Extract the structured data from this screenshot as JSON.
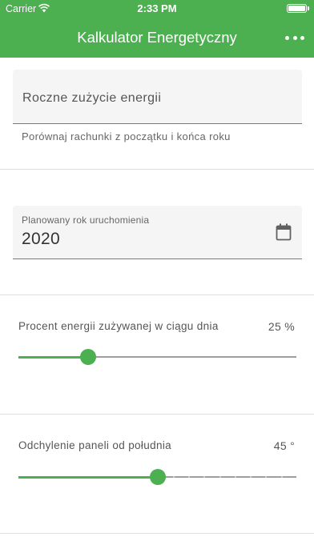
{
  "status_bar": {
    "carrier": "Carrier",
    "time": "2:33 PM"
  },
  "app_bar": {
    "title": "Kalkulator Energetyczny",
    "menu_icon": "more-horiz-icon"
  },
  "energy_field": {
    "placeholder": "Roczne zużycie energii",
    "value": "",
    "helper": "Porównaj rachunki z początku i końca roku"
  },
  "year_field": {
    "label": "Planowany rok uruchomienia",
    "value": "2020",
    "icon": "calendar-icon"
  },
  "day_energy_slider": {
    "label": "Procent energii zużywanej w ciągu dnia",
    "value_text": "25 %",
    "value_fraction": 0.25
  },
  "panel_angle_slider": {
    "label": "Odchylenie paneli od południa",
    "value_text": "45 °",
    "value_fraction": 0.5,
    "divisions": 18
  },
  "colors": {
    "accent": "#4caf50",
    "track_inactive": "#9e9e9e"
  }
}
